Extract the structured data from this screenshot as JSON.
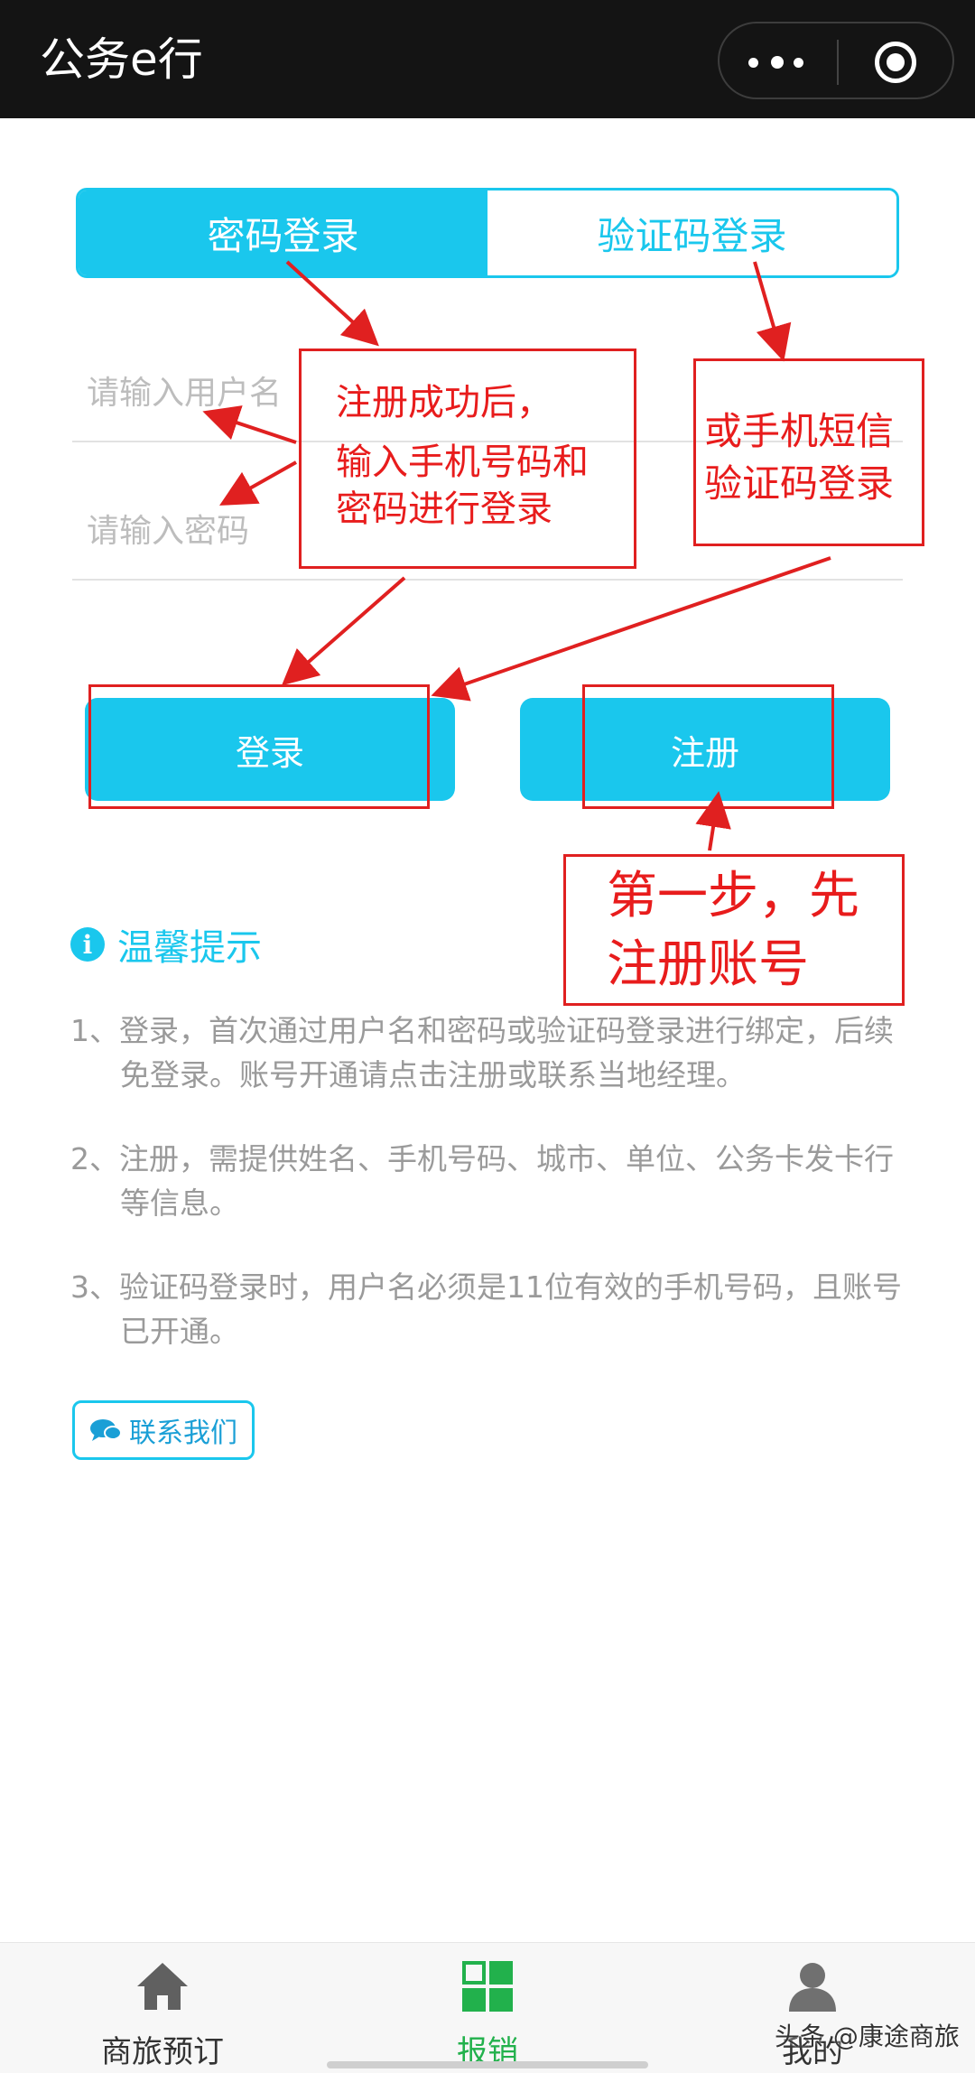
{
  "topbar": {
    "title": "公务e行",
    "more_icon": "more-dots-icon",
    "close_icon": "target-circle-icon"
  },
  "tabs": [
    {
      "label": "密码登录",
      "active": true
    },
    {
      "label": "验证码登录",
      "active": false
    }
  ],
  "form": {
    "username_placeholder": "请输入用户名",
    "password_placeholder": "请输入密码",
    "login_label": "登录",
    "register_label": "注册"
  },
  "tips": {
    "title": "温馨提示",
    "items": [
      "1、登录，首次通过用户名和密码或验证码登录进行绑定，后续免登录。账号开通请点击注册或联系当地经理。",
      "2、注册，需提供姓名、手机号码、城市、单位、公务卡发卡行等信息。",
      "3、验证码登录时，用户名必须是11位有效的手机号码，且账号已开通。"
    ],
    "contact_label": "联系我们"
  },
  "annotations": {
    "login_note": [
      "注册成功后，",
      "输入手机号码和",
      "密码进行登录"
    ],
    "sms_note": [
      "或手机短信",
      "验证码登录"
    ],
    "register_note": [
      "第一步，先",
      "注册账号"
    ]
  },
  "bottom_nav": [
    {
      "label": "商旅预订",
      "icon": "home-icon",
      "color": "#333333"
    },
    {
      "label": "报销",
      "icon": "grid-icon",
      "color": "#22b14c"
    },
    {
      "label": "我的",
      "icon": "user-icon",
      "color": "#333333"
    }
  ],
  "watermark": "头条 @康途商旅",
  "colors": {
    "accent": "#1ac7ed",
    "annotation": "#e02020",
    "active_nav": "#22b14c"
  }
}
